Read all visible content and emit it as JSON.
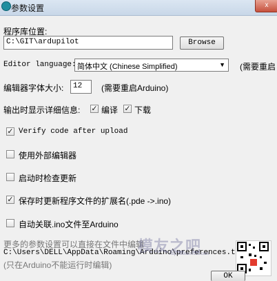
{
  "window": {
    "title": "参数设置",
    "close_glyph": "x"
  },
  "sketchbook": {
    "label": "程序库位置:",
    "path": "C:\\GIT\\ardupilot",
    "browse_label": "Browse"
  },
  "editor_language": {
    "label": "Editor language:",
    "selected": "简体中文 (Chinese Simplified)",
    "note": "(需要重启"
  },
  "font_size": {
    "label": "编辑器字体大小:",
    "value": "12",
    "note": "(需要重启Arduino)"
  },
  "verbose": {
    "label": "输出时显示详细信息:",
    "compile_label": "编译",
    "compile_checked": true,
    "upload_label": "下载",
    "upload_checked": true
  },
  "options": [
    {
      "label": "Verify code after upload",
      "checked": true
    },
    {
      "label": "使用外部编辑器",
      "checked": false
    },
    {
      "label": "启动时检查更新",
      "checked": false
    },
    {
      "label": "保存时更新程序文件的扩展名(.pde ->.ino)",
      "checked": true
    },
    {
      "label": "自动关联.ino文件至Arduino",
      "checked": false
    }
  ],
  "footer": {
    "more_text": "更多的参数设置可以直接在文件中编辑",
    "path": "C:\\Users\\DELL\\AppData\\Roaming\\Arduino\\preferences.txt",
    "hint": "(只在Arduino不能运行时编辑)",
    "ok_label": "OK"
  },
  "watermark": {
    "text": "模友之吧",
    "url": "http://www.moz8.com"
  },
  "icons": {
    "app": "arduino-icon",
    "close": "close-icon",
    "dropdown": "chevron-down-icon",
    "check": "check-icon"
  }
}
